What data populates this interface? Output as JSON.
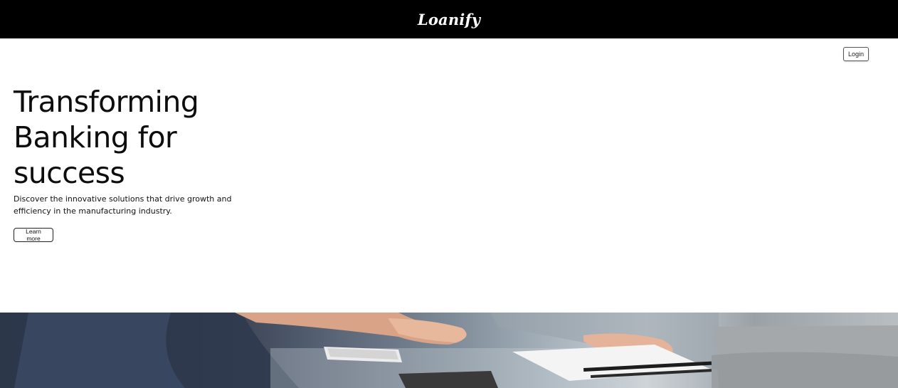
{
  "header": {
    "logo_text": "Loanify"
  },
  "nav": {
    "login_label": "Login"
  },
  "hero": {
    "headline": "Transforming Banking for success",
    "subtext": "Discover the innovative solutions that drive growth and efficiency in the manufacturing industry.",
    "cta_label": "Learn more"
  },
  "colors": {
    "header_bg": "#000000",
    "page_bg": "#ffffff",
    "text": "#111111"
  },
  "icons": [
    "photo-business-meeting"
  ]
}
